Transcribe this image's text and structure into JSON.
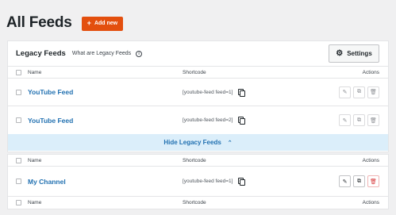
{
  "header": {
    "title": "All Feeds",
    "add_button_label": "Add new",
    "add_icon": "+"
  },
  "legacy": {
    "title": "Legacy Feeds",
    "what_label": "What are Legacy Feeds",
    "settings_label": "Settings",
    "columns": {
      "name": "Name",
      "shortcode": "Shortcode",
      "actions": "Actions"
    },
    "rows": [
      {
        "name": "YouTube Feed",
        "shortcode": "[youtube-feed feed=1]"
      },
      {
        "name": "YouTube Feed",
        "shortcode": "[youtube-feed feed=2]"
      }
    ],
    "toggle_label": "Hide Legacy Feeds"
  },
  "feeds": {
    "columns": {
      "name": "Name",
      "shortcode": "Shortcode",
      "actions": "Actions"
    },
    "rows": [
      {
        "name": "My Channel",
        "shortcode": "[youtube-feed feed=1]"
      }
    ],
    "footer_columns": {
      "name": "Name",
      "shortcode": "Shortcode",
      "actions": "Actions"
    }
  },
  "colors": {
    "accent": "#e34f0e",
    "link": "#2271b1",
    "toggle_bg": "#dbeefa",
    "delete": "#d63638"
  },
  "icons": [
    "plus-icon",
    "info-icon",
    "gear-icon",
    "copy-icon",
    "edit-icon",
    "duplicate-icon",
    "trash-icon",
    "chevron-up-icon"
  ]
}
